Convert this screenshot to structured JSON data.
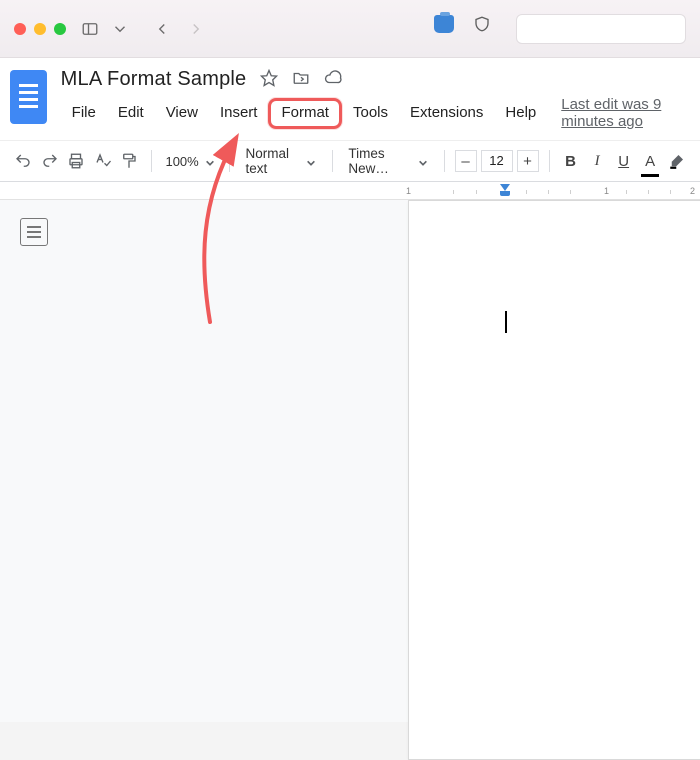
{
  "doc": {
    "title": "MLA Format Sample"
  },
  "menu": {
    "items": [
      "File",
      "Edit",
      "View",
      "Insert",
      "Format",
      "Tools",
      "Extensions",
      "Help"
    ],
    "highlighted": "Format",
    "last_edit": "Last edit was 9 minutes ago"
  },
  "toolbar": {
    "zoom": "100%",
    "style": "Normal text",
    "font": "Times New…",
    "font_size": "12",
    "minus": "–",
    "plus": "+",
    "bold": "B",
    "italic": "I",
    "underline": "U",
    "text_color": "A"
  },
  "ruler": {
    "marks": [
      "1",
      "1",
      "2"
    ]
  },
  "icons": {
    "star": "star-icon",
    "move": "folder-move-icon",
    "cloud": "cloud-saved-icon"
  }
}
